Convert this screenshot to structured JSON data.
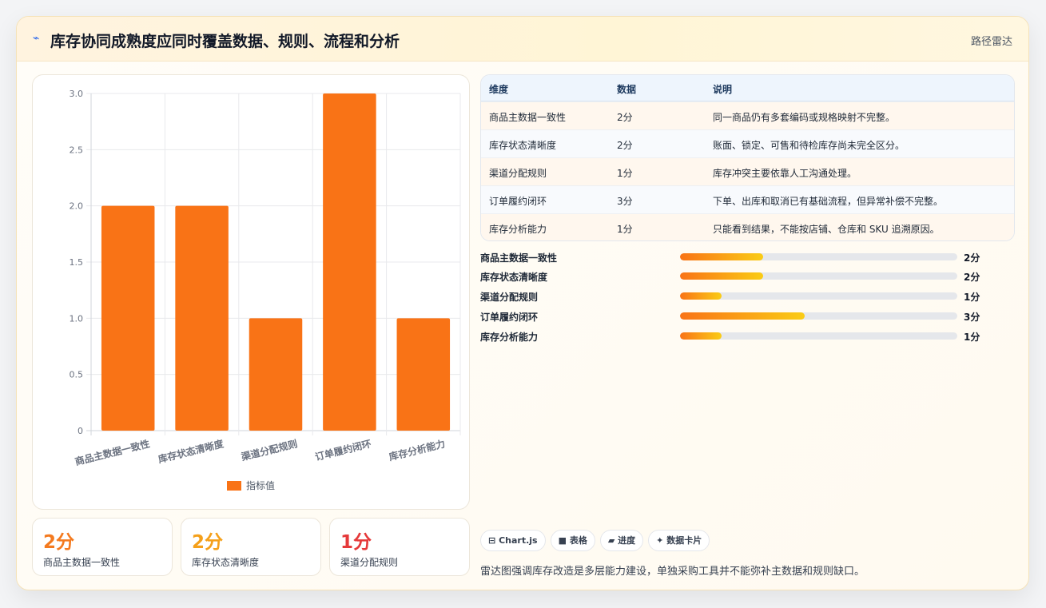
{
  "header": {
    "icon": "chart-line-icon",
    "title": "库存协同成熟度应同时覆盖数据、规则、流程和分析",
    "link_label": "路径雷达"
  },
  "chart_data": {
    "type": "bar",
    "categories": [
      "商品主数据一致性",
      "库存状态清晰度",
      "渠道分配规则",
      "订单履约闭环",
      "库存分析能力"
    ],
    "series": [
      {
        "name": "指标值",
        "values": [
          2,
          2,
          1,
          3,
          1
        ],
        "color": "#f97316"
      }
    ],
    "ylim": [
      0,
      3
    ],
    "yticks": [
      "0",
      "0.5",
      "1.0",
      "1.5",
      "2.0",
      "2.5",
      "3.0"
    ],
    "grid": true,
    "legend": "bottom"
  },
  "stats": [
    {
      "value": "2分",
      "label": "商品主数据一致性",
      "color": "#f47a1f"
    },
    {
      "value": "2分",
      "label": "库存状态清晰度",
      "color": "#f5a01a"
    },
    {
      "value": "1分",
      "label": "渠道分配规则",
      "color": "#e5393a"
    }
  ],
  "table": {
    "headers": [
      "维度",
      "数据",
      "说明"
    ],
    "rows": [
      {
        "dim": "商品主数据一致性",
        "score": "2分",
        "note": "同一商品仍有多套编码或规格映射不完整。"
      },
      {
        "dim": "库存状态清晰度",
        "score": "2分",
        "note": "账面、锁定、可售和待检库存尚未完全区分。"
      },
      {
        "dim": "渠道分配规则",
        "score": "1分",
        "note": "库存冲突主要依靠人工沟通处理。"
      },
      {
        "dim": "订单履约闭环",
        "score": "3分",
        "note": "下单、出库和取消已有基础流程，但异常补偿不完整。"
      },
      {
        "dim": "库存分析能力",
        "score": "1分",
        "note": "只能看到结果，不能按店铺、仓库和 SKU 追溯原因。"
      }
    ],
    "row_colors": [
      "#fff7ee",
      "#f8fafd",
      "#fff7ee",
      "#f8fafd",
      "#fff7ee"
    ]
  },
  "progress": [
    {
      "label": "商品主数据一致性",
      "value": "2分",
      "fraction": 0.3
    },
    {
      "label": "库存状态清晰度",
      "value": "2分",
      "fraction": 0.3
    },
    {
      "label": "渠道分配规则",
      "value": "1分",
      "fraction": 0.15
    },
    {
      "label": "订单履约闭环",
      "value": "3分",
      "fraction": 0.45
    },
    {
      "label": "库存分析能力",
      "value": "1分",
      "fraction": 0.15
    }
  ],
  "tags": [
    {
      "icon": "chart-icon",
      "glyph": "⊟",
      "label": "Chart.js"
    },
    {
      "icon": "table-icon",
      "glyph": "■",
      "label": "表格"
    },
    {
      "icon": "progress-icon",
      "glyph": "▰",
      "label": "进度"
    },
    {
      "icon": "card-icon",
      "glyph": "✦",
      "label": "数据卡片"
    }
  ],
  "footnote": "雷达图强调库存改造是多层能力建设，单独采购工具并不能弥补主数据和规则缺口。"
}
